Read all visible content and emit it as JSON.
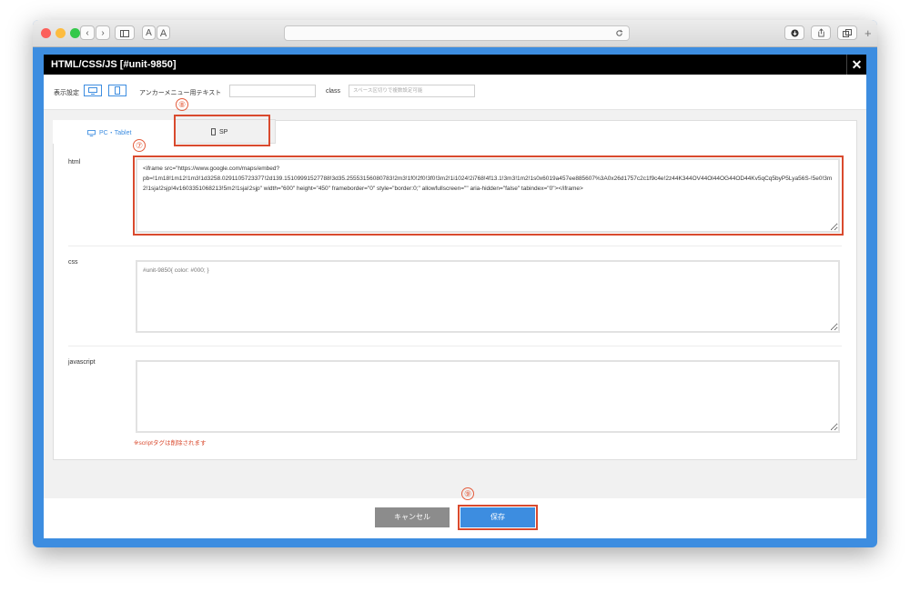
{
  "modal": {
    "title": "HTML/CSS/JS [#unit-9850]",
    "close": "✕"
  },
  "settings": {
    "display_label": "表示設定",
    "anchor_label": "アンカーメニュー用テキスト",
    "anchor_value": "",
    "class_label": "class",
    "class_placeholder": "スペース区切りで複数設定可能"
  },
  "tabs": [
    {
      "label": "PC・Tablet"
    },
    {
      "label": "SP"
    }
  ],
  "fields": {
    "html_label": "html",
    "html_value": "<iframe src=\"https://www.google.com/maps/embed?pb=!1m18!1m12!1m3!1d3258.0291105723377!2d139.15109991527788!3d35.25553156080783!2m3!1f0!2f0!3f0!3m2!1i1024!2i768!4f13.1!3m3!1m2!1s0x6019a457ee885607%3A0x26d1757c2c1f9c4e!2z44K344OV44Ol44OG44OD44Kv5qCq5byP5Lya56S-!5e0!3m2!1sja!2sjp!4v1603351068213!5m2!1sja!2sjp\" width=\"600\" height=\"450\" frameborder=\"0\" style=\"border:0;\" allowfullscreen=\"\" aria-hidden=\"false\" tabindex=\"0\"></iframe>",
    "css_label": "css",
    "css_placeholder": "#unit-9850{ color: #000; }",
    "js_label": "javascript",
    "js_note": "※scriptタグは削除されます"
  },
  "annotations": {
    "n7": "⑦",
    "n8": "⑧",
    "n9": "⑨"
  },
  "footer": {
    "cancel": "キャンセル",
    "save": "保存"
  },
  "colors": {
    "accent": "#3d8de0",
    "annotation_red": "#d94a2e",
    "header_bg": "#000000",
    "cancel_bg": "#8c8c8c",
    "save_bg": "#3d8de0"
  },
  "icons": [
    "back-icon",
    "forward-icon",
    "sidebar-icon",
    "reload-icon",
    "download-icon",
    "share-icon",
    "tabs-icon",
    "new-tab-icon",
    "monitor-icon",
    "smartphone-icon",
    "close-icon",
    "resize-grip-icon"
  ]
}
